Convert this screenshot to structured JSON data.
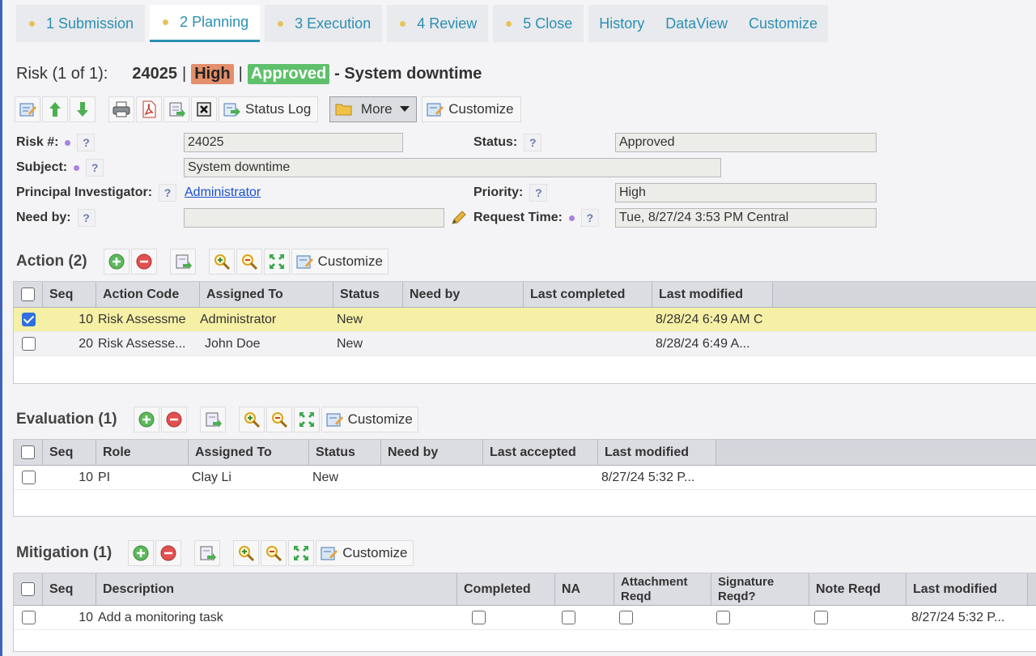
{
  "tabs": [
    {
      "label": "1 Submission",
      "dot": true
    },
    {
      "label": "2 Planning",
      "dot": true,
      "active": true
    },
    {
      "label": "3 Execution",
      "dot": true
    },
    {
      "label": "4 Review",
      "dot": true
    },
    {
      "label": "5 Close",
      "dot": true
    },
    {
      "label": "History",
      "dot": false
    },
    {
      "label": "DataView",
      "dot": false
    },
    {
      "label": "Customize",
      "dot": false
    }
  ],
  "header": {
    "label": "Risk (1 of 1):",
    "number": "24025",
    "sep": "|",
    "priority_badge": "High",
    "status_badge": "Approved",
    "subject": "- System downtime"
  },
  "toolbar": {
    "status_log": "Status Log",
    "more": "More",
    "customize": "Customize"
  },
  "form": {
    "risk_label": "Risk #:",
    "risk_value": "24025",
    "status_label": "Status:",
    "status_value": "Approved",
    "subject_label": "Subject:",
    "subject_value": "System downtime",
    "pi_label": "Principal Investigator:",
    "pi_value": "Administrator",
    "priority_label": "Priority:",
    "priority_value": "High",
    "needby_label": "Need by:",
    "needby_value": "",
    "reqtime_label": "Request Time:",
    "reqtime_value": "Tue, 8/27/24 3:53 PM Central",
    "help": "?"
  },
  "action": {
    "title": "Action (2)",
    "customize": "Customize",
    "columns": [
      "Seq",
      "Action Code",
      "Assigned To",
      "Status",
      "Need by",
      "Last completed",
      "Last modified"
    ],
    "rows": [
      {
        "seq": "10",
        "code": "Risk Assessme",
        "assigned": "Administrator",
        "status": "New",
        "needby": "",
        "completed": "",
        "modified": "8/28/24 6:49 AM C",
        "checked": true
      },
      {
        "seq": "20",
        "code": "Risk Assesse...",
        "assigned": "John Doe",
        "status": "New",
        "needby": "",
        "completed": "",
        "modified": "8/28/24 6:49 A...",
        "checked": false
      }
    ]
  },
  "evaluation": {
    "title": "Evaluation (1)",
    "customize": "Customize",
    "columns": [
      "Seq",
      "Role",
      "Assigned To",
      "Status",
      "Need by",
      "Last accepted",
      "Last modified"
    ],
    "rows": [
      {
        "seq": "10",
        "role": "PI",
        "assigned": "Clay Li",
        "status": "New",
        "needby": "",
        "accepted": "",
        "modified": "8/27/24 5:32 P..."
      }
    ]
  },
  "mitigation": {
    "title": "Mitigation (1)",
    "customize": "Customize",
    "columns": [
      "Seq",
      "Description",
      "Completed",
      "NA",
      "Attachment Reqd",
      "Signature Reqd?",
      "Note Reqd",
      "Last modified"
    ],
    "rows": [
      {
        "seq": "10",
        "description": "Add a monitoring task",
        "modified": "8/27/24 5:32 P..."
      }
    ]
  },
  "colors": {
    "accent": "#2b8fb4",
    "high": "#e48f6c",
    "approved": "#5fc06c",
    "selected_row": "#f6f0a6"
  }
}
